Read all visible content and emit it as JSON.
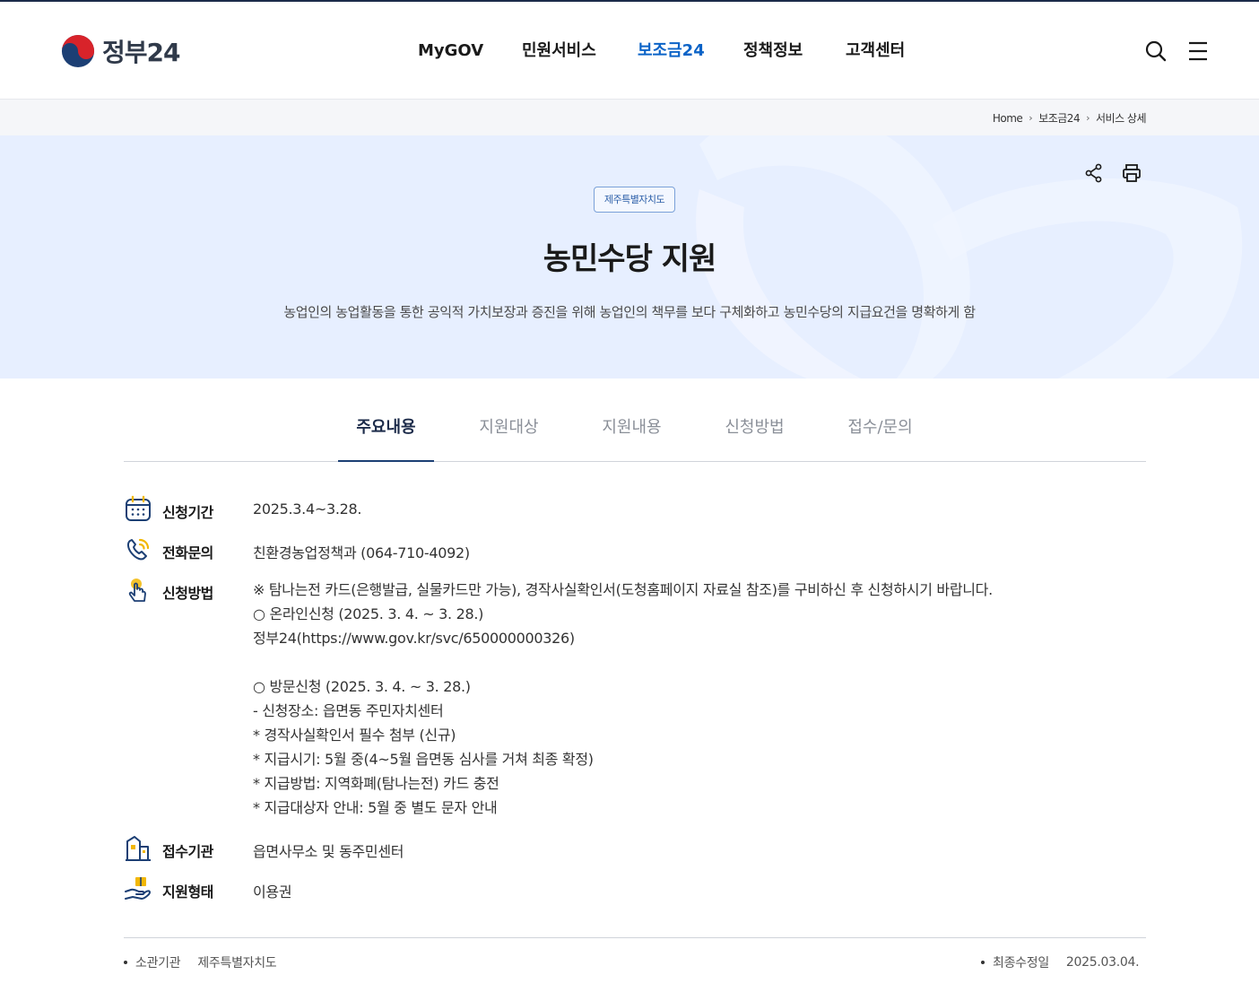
{
  "header": {
    "logo_text": "정부24",
    "nav": [
      {
        "label": "MyGOV",
        "active": false
      },
      {
        "label": "민원서비스",
        "active": false
      },
      {
        "label": "보조금24",
        "active": true
      },
      {
        "label": "정책정보",
        "active": false
      },
      {
        "label": "고객센터",
        "active": false
      }
    ],
    "search_icon": "search-icon",
    "menu_icon": "hamburger-icon"
  },
  "breadcrumb": {
    "home": "Home",
    "level1": "보조금24",
    "level2": "서비스 상세"
  },
  "hero": {
    "badge": "제주특별자치도",
    "title": "농민수당 지원",
    "description": "농업인의 농업활동을 통한 공익적 가치보장과 증진을 위해 농업인의 책무를 보다 구체화하고 농민수당의 지급요건을 명확하게 함",
    "share_icon": "share-icon",
    "print_icon": "print-icon"
  },
  "tabs": [
    {
      "label": "주요내용",
      "active": true
    },
    {
      "label": "지원대상",
      "active": false
    },
    {
      "label": "지원내용",
      "active": false
    },
    {
      "label": "신청방법",
      "active": false
    },
    {
      "label": "접수/문의",
      "active": false
    }
  ],
  "info": {
    "period": {
      "label": "신청기간",
      "value": "2025.3.4~3.28.",
      "icon": "calendar-icon"
    },
    "phone": {
      "label": "전화문의",
      "value": "친환경농업정책과 (064-710-4092)",
      "icon": "phone-icon"
    },
    "method": {
      "label": "신청방법",
      "icon": "touch-hand-icon",
      "lines": [
        "※ 탐나는전 카드(은행발급, 실물카드만 가능), 경작사실확인서(도청홈페이지 자료실 참조)를 구비하신 후 신청하시기 바랍니다.",
        "○ 온라인신청 (2025. 3. 4. ~ 3. 28.)",
        "정부24(https://www.gov.kr/svc/650000000326)",
        "",
        "○ 방문신청 (2025. 3. 4. ~ 3. 28.)",
        "- 신청장소: 읍면동 주민자치센터",
        "* 경작사실확인서 필수 첨부 (신규)",
        "* 지급시기: 5월 중(4~5월 읍면동 심사를 거쳐 최종 확정)",
        "* 지급방법: 지역화폐(탐나는전) 카드 충전",
        "* 지급대상자 안내: 5월 중 별도 문자 안내"
      ]
    },
    "agency": {
      "label": "접수기관",
      "value": "읍면사무소 및 동주민센터",
      "icon": "building-icon"
    },
    "support_type": {
      "label": "지원형태",
      "value": "이용권",
      "icon": "hand-gift-icon"
    }
  },
  "footer_meta": {
    "dept_label": "소관기관",
    "dept_value": "제주특별자치도",
    "updated_label": "최종수정일",
    "updated_value": "2025.03.04."
  },
  "colors": {
    "accent": "#0b63c7",
    "hero_bg": "#e7efff",
    "icon_navy": "#1c3f74",
    "icon_yellow": "#f2b705"
  }
}
